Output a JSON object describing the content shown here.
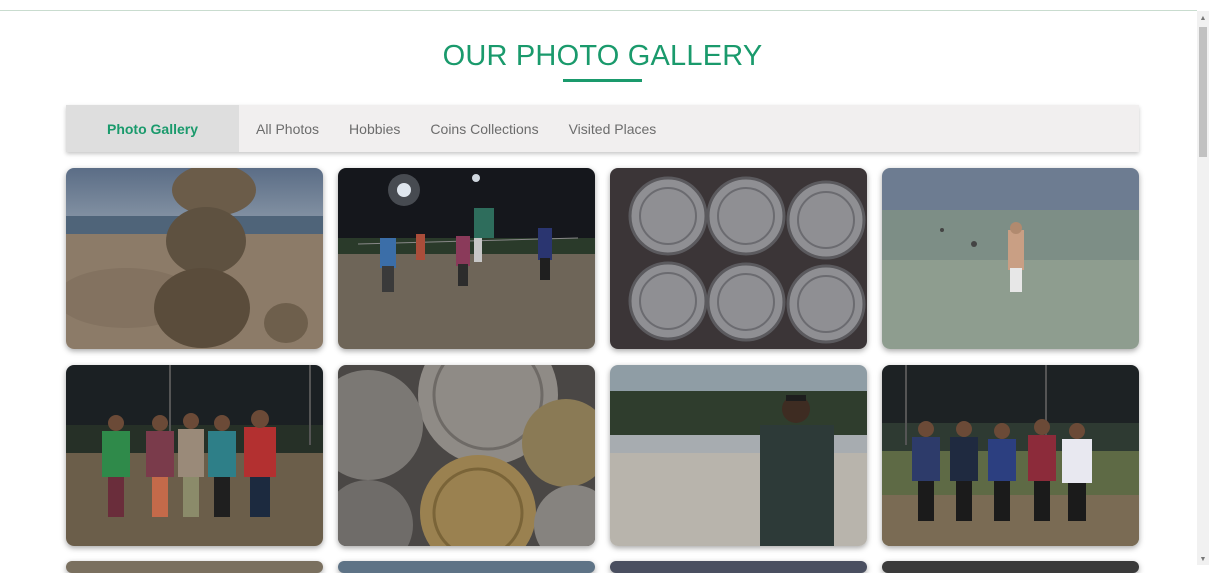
{
  "page": {
    "title": "OUR PHOTO GALLERY",
    "accent_color": "#1a9a6c"
  },
  "tabs": [
    {
      "label": "Photo Gallery",
      "active": true
    },
    {
      "label": "All Photos",
      "active": false
    },
    {
      "label": "Hobbies",
      "active": false
    },
    {
      "label": "Coins Collections",
      "active": false
    },
    {
      "label": "Visited Places",
      "active": false
    }
  ],
  "gallery": {
    "photos": [
      {
        "subject": "sand-ball-stack-on-beach"
      },
      {
        "subject": "volleyball-court-at-night"
      },
      {
        "subject": "coins-grid"
      },
      {
        "subject": "man-in-sea"
      },
      {
        "subject": "group-of-five-at-night"
      },
      {
        "subject": "coins-pile"
      },
      {
        "subject": "man-at-lagoon"
      },
      {
        "subject": "team-of-five-on-field"
      }
    ]
  },
  "scrollbar": {
    "up_icon": "▲",
    "down_icon": "▼"
  }
}
